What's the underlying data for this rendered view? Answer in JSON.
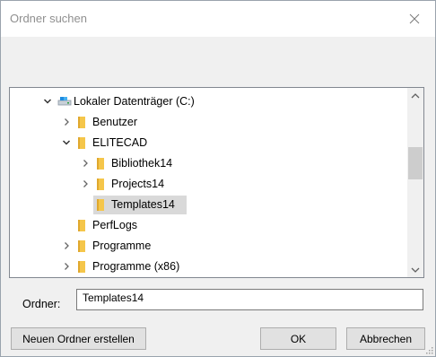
{
  "window": {
    "title": "Ordner suchen"
  },
  "tree": {
    "items": [
      {
        "label": "Lokaler Datenträger (C:)",
        "level": 0,
        "expander": "expanded",
        "icon": "drive-icon",
        "selected": false
      },
      {
        "label": "Benutzer",
        "level": 1,
        "expander": "collapsed",
        "icon": "folder-icon",
        "selected": false
      },
      {
        "label": "ELITECAD",
        "level": 1,
        "expander": "expanded",
        "icon": "folder-icon",
        "selected": false
      },
      {
        "label": "Bibliothek14",
        "level": 2,
        "expander": "collapsed",
        "icon": "folder-icon",
        "selected": false
      },
      {
        "label": "Projects14",
        "level": 2,
        "expander": "collapsed",
        "icon": "folder-icon",
        "selected": false
      },
      {
        "label": "Templates14",
        "level": 2,
        "expander": "none",
        "icon": "folder-icon",
        "selected": true
      },
      {
        "label": "PerfLogs",
        "level": 1,
        "expander": "none",
        "icon": "folder-icon",
        "selected": false
      },
      {
        "label": "Programme",
        "level": 1,
        "expander": "collapsed",
        "icon": "folder-icon",
        "selected": false
      },
      {
        "label": "Programme (x86)",
        "level": 1,
        "expander": "collapsed",
        "icon": "folder-icon",
        "selected": false
      }
    ]
  },
  "folder_field": {
    "label": "Ordner:",
    "value": "Templates14"
  },
  "buttons": {
    "new_folder": "Neuen Ordner erstellen",
    "ok": "OK",
    "cancel": "Abbrechen"
  },
  "colors": {
    "folder": "#f5c64a",
    "selection": "#d9d9d9",
    "dialog_bg": "#f0f0f0"
  }
}
